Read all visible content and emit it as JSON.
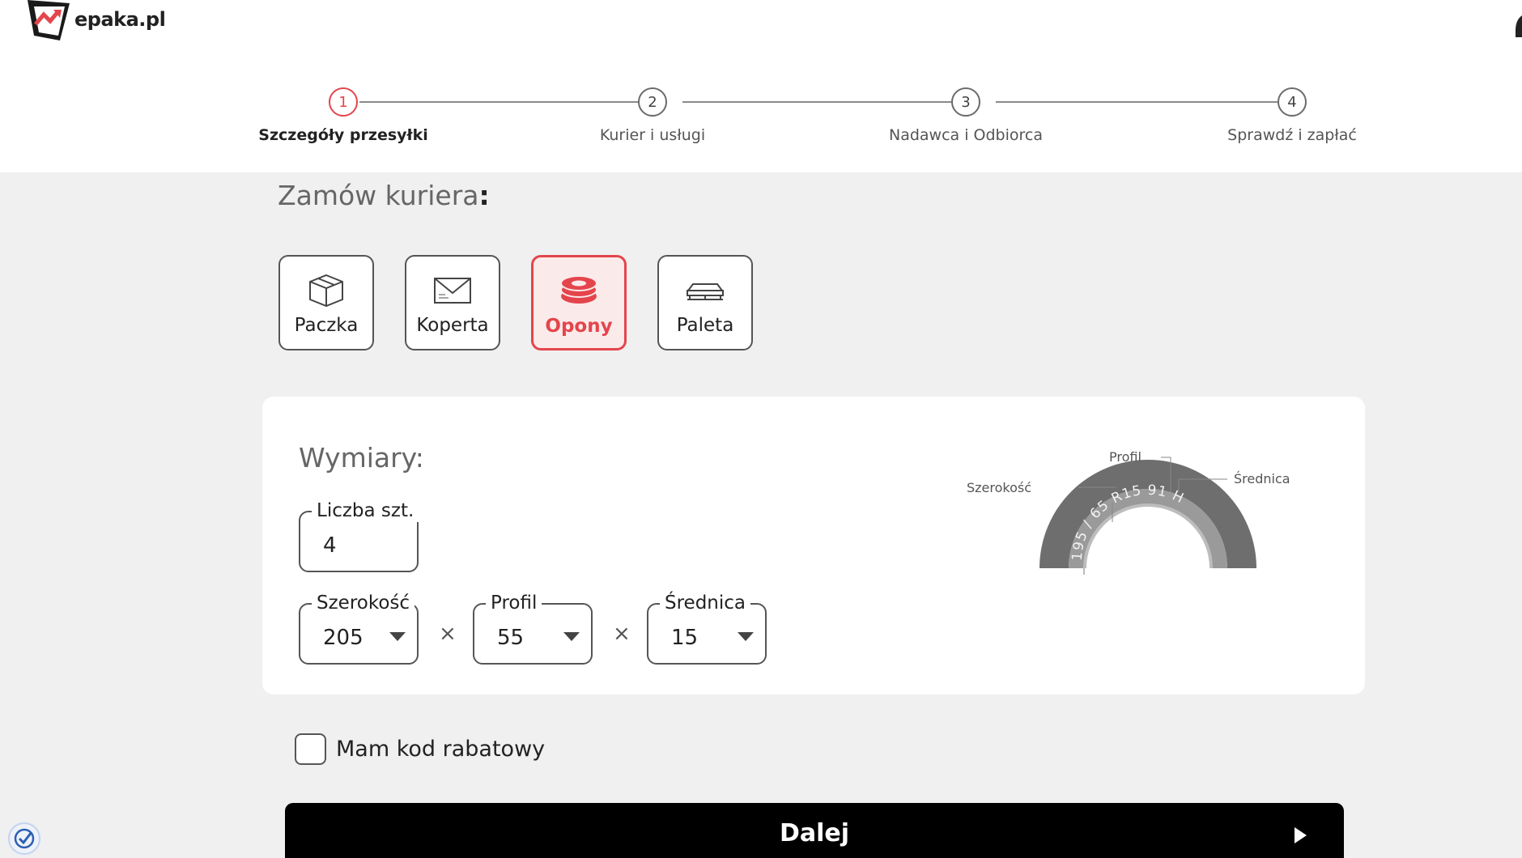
{
  "brand": {
    "name": "epaka.pl",
    "accent": "#e4454c"
  },
  "stepper": {
    "steps": [
      {
        "number": "1",
        "label": "Szczegóły przesyłki",
        "active": true
      },
      {
        "number": "2",
        "label": "Kurier i usługi",
        "active": false
      },
      {
        "number": "3",
        "label": "Nadawca i Odbiorca",
        "active": false
      },
      {
        "number": "4",
        "label": "Sprawdź i zapłać",
        "active": false
      }
    ]
  },
  "order": {
    "title": "Zamów kuriera",
    "colon": ":",
    "types": [
      {
        "label": "Paczka",
        "icon": "box-icon",
        "selected": false
      },
      {
        "label": "Koperta",
        "icon": "envelope-icon",
        "selected": false
      },
      {
        "label": "Opony",
        "icon": "tires-icon",
        "selected": true
      },
      {
        "label": "Paleta",
        "icon": "pallet-icon",
        "selected": false
      }
    ]
  },
  "dimensions": {
    "title": "Wymiary:",
    "quantity": {
      "label": "Liczba szt.",
      "value": "4"
    },
    "width": {
      "label": "Szerokość",
      "value": "205"
    },
    "profile": {
      "label": "Profil",
      "value": "55"
    },
    "diameter": {
      "label": "Średnica",
      "value": "15"
    },
    "separator": "×",
    "diagram": {
      "label_width": "Szerokość",
      "label_profile": "Profil",
      "label_diameter": "Średnica",
      "tire_text": "195 / 65 R15 91 H"
    }
  },
  "discount": {
    "label": "Mam kod rabatowy",
    "checked": false
  },
  "next_button": {
    "label": "Dalej"
  }
}
